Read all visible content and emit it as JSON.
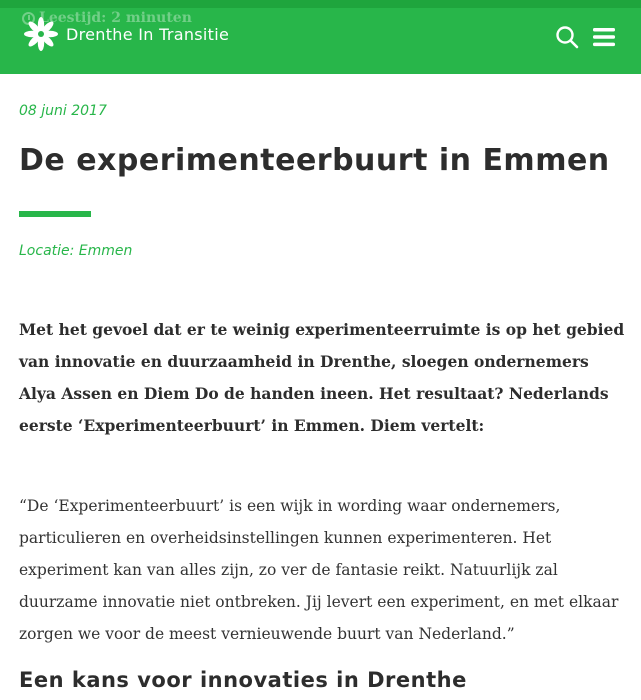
{
  "header": {
    "site_name": "Drenthe In Transitie",
    "reading_time": "Leestijd: 2 minuten",
    "logo_icon": "flower-logo-icon",
    "search_icon": "search-icon",
    "menu_icon": "hamburger-menu-icon",
    "brand_color": "#28b64a"
  },
  "article": {
    "date": "08 juni 2017",
    "title": "De experimenteerbuurt in Emmen",
    "location": "Locatie: Emmen",
    "intro": "Met het gevoel dat er te weinig experimenteerruimte is op het gebied van innovatie en duurzaamheid in Drenthe, sloegen ondernemers Alya Assen en Diem Do de handen ineen. Het resultaat? Nederlands eerste ‘Experimenteerbuurt’ in Emmen. Diem vertelt:",
    "quote": "“De ‘Experimenteerbuurt’ is een wijk in wording waar ondernemers, particulieren en overheidsinstellingen kunnen experimenteren. Het experiment kan van alles zijn, zo ver de fantasie reikt. Natuurlijk zal duurzame innovatie niet ontbreken. Jij levert een experiment, en met elkaar zorgen we voor de meest vernieuwende buurt van Nederland.”",
    "subheading": "Een kans voor innovaties in Drenthe"
  }
}
